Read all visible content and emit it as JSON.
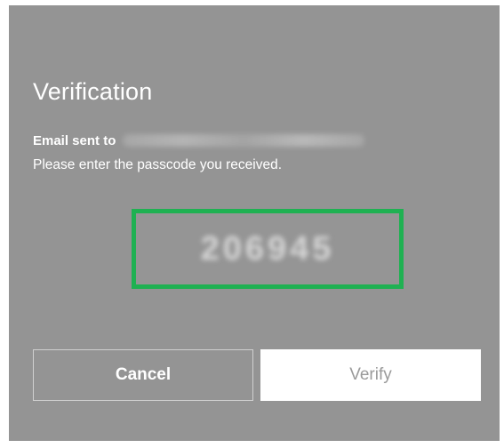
{
  "dialog": {
    "title": "Verification",
    "email_label": "Email sent to",
    "instructions": "Please enter the passcode you received.",
    "passcode": "206945",
    "cancel_label": "Cancel",
    "verify_label": "Verify"
  },
  "colors": {
    "dialog_background": "#949494",
    "highlight_border": "#1fb152",
    "text": "#ffffff",
    "verify_button_background": "#ffffff",
    "verify_button_text": "#9a9a9a"
  }
}
